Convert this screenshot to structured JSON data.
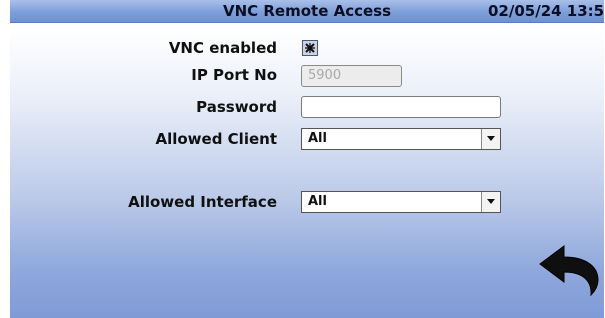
{
  "titlebar": {
    "title": "VNC Remote Access",
    "datetime": "02/05/24 13:5"
  },
  "form": {
    "vnc_enabled_label": "VNC enabled",
    "vnc_enabled_checked": true,
    "ip_port_label": "IP Port No",
    "ip_port_value": "5900",
    "password_label": "Password",
    "password_value": "",
    "allowed_client_label": "Allowed Client",
    "allowed_client_value": "All",
    "allowed_interface_label": "Allowed Interface",
    "allowed_interface_value": "All"
  },
  "icons": {
    "checkbox_mark": "x-mark-icon",
    "dropdown": "chevron-down-icon",
    "back": "back-arrow-icon"
  },
  "colors": {
    "titlebar": "#7d9ed9",
    "background_bottom": "#7f9bd7"
  }
}
